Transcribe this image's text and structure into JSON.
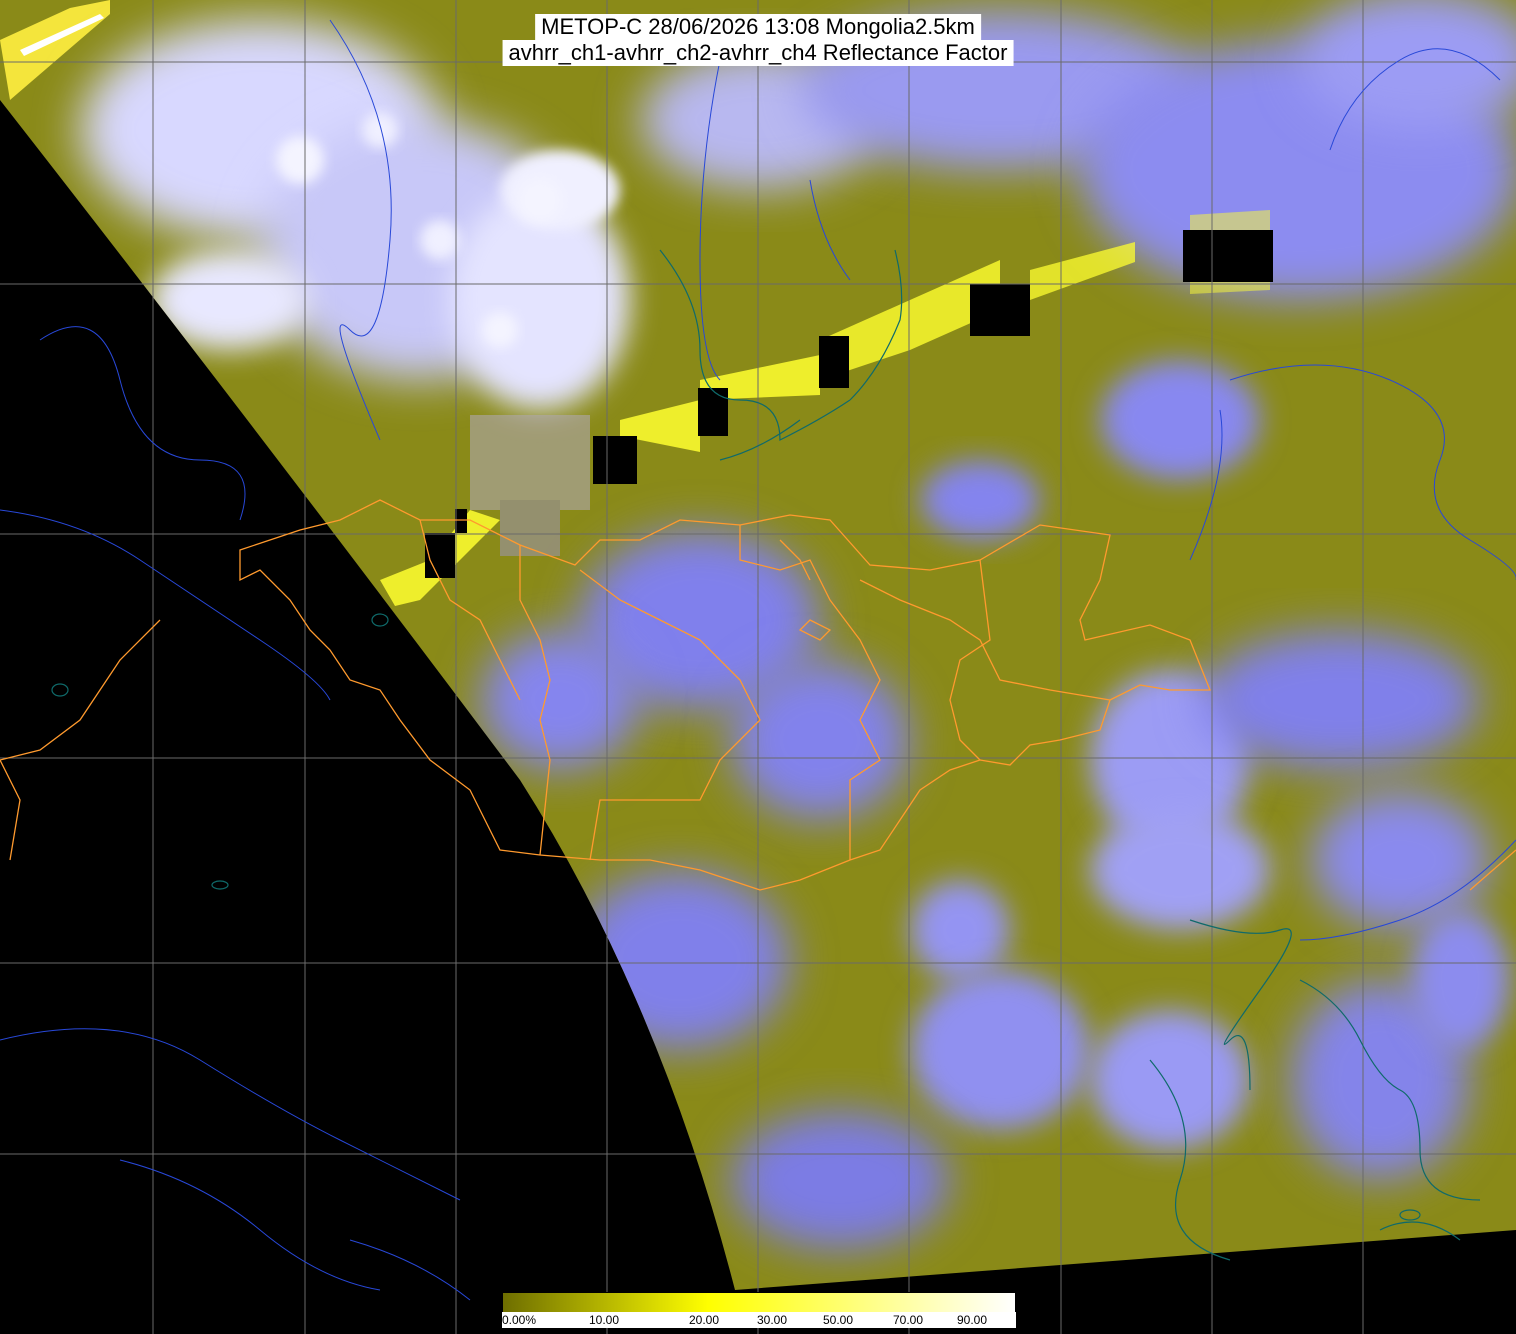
{
  "title": {
    "line1": "METOP-C 28/06/2026 13:08 Mongolia2.5km",
    "line2": "avhrr_ch1-avhrr_ch2-avhrr_ch4 Reflectance Factor"
  },
  "colorbar": {
    "ticks": [
      "0.00%",
      "10.00",
      "20.00",
      "30.00",
      "50.00",
      "70.00",
      "90.00"
    ],
    "colors": {
      "low": "#6e6e00",
      "mid": "#ffff00",
      "high": "#ffffff"
    }
  },
  "colors": {
    "no_data": "#000000",
    "surface": "#8a8a18",
    "cloud": "#8080f0",
    "bright_cloud": "#e6e6ff",
    "mongolia_borders": "#ff9a2e",
    "coastlines": "#0f6a6a",
    "rivers": "#2848d8",
    "grid": "#6a6a6a"
  }
}
